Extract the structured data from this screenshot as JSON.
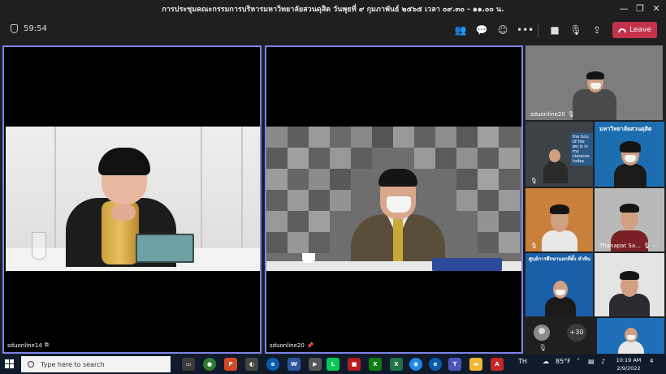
{
  "window": {
    "title": "การประชุมคณะกรรมการบริหารมหาวิทยาลัยสวนดุสิต วันพุธที่ ๙ กุมภาพันธ์ ๒๕๖๕ เวลา ๐๙.๓๐ - ๑๑.๐๐ น."
  },
  "toolbar": {
    "timer": "59:54",
    "leave_label": "Leave"
  },
  "main_tiles": [
    {
      "name": "sduonline14"
    },
    {
      "name": "sduonline20"
    }
  ],
  "side_tiles": [
    {
      "name": "sduonline20",
      "text": ""
    },
    {
      "name": "",
      "text": "the futu of the wo is in my classroo today"
    },
    {
      "name": "",
      "text": "มหาวิทยาลัยสวนดุสิต"
    },
    {
      "name": "",
      "text": ""
    },
    {
      "name": "Thanapat Sa...",
      "text": ""
    },
    {
      "name": "",
      "text": "ศูนย์การศึกษานอกที่ตั้ง หัวหิน"
    }
  ],
  "overflow": {
    "count_label": "+30"
  },
  "taskbar": {
    "search_placeholder": "Type here to search",
    "language": "TH",
    "weather": "85°F",
    "time": "10:19 AM",
    "date": "2/9/2022",
    "notification_count": "4"
  },
  "colors": {
    "accent_border": "#7b83eb",
    "leave_button": "#c4314b",
    "taskbar": "#0f1a2b"
  }
}
